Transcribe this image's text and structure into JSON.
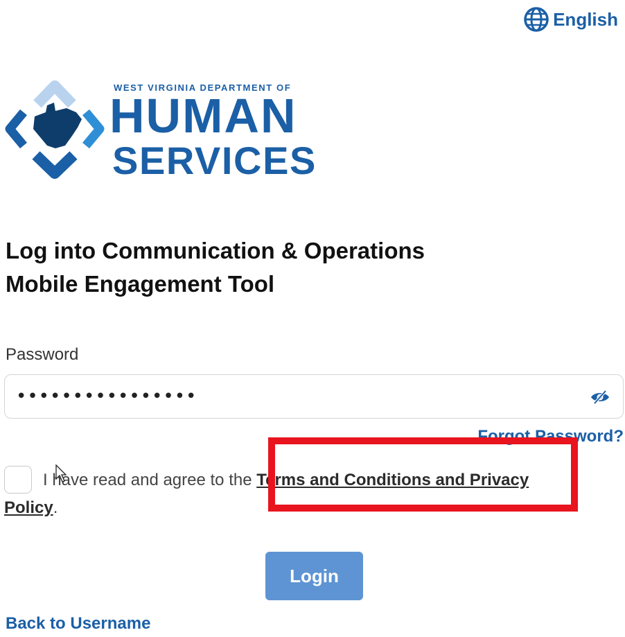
{
  "header": {
    "language_label": "English",
    "language_icon": "globe-icon"
  },
  "logo": {
    "line1": "WEST VIRGINIA DEPARTMENT OF",
    "line2": "HUMAN",
    "line3": "SERVICES"
  },
  "page": {
    "title_line1": "Log into Communication & Operations",
    "title_line2": "Mobile Engagement Tool"
  },
  "form": {
    "password_label": "Password",
    "password_value": "••••••••••••••••",
    "password_visibility_icon": "eye-slash-icon",
    "forgot_password": "Forgot Password?",
    "agree_prefix": "I have read and agree to the",
    "terms_link": "Terms and Conditions and Privacy Policy",
    "agree_suffix": ".",
    "checkbox_checked": false,
    "login_button": "Login",
    "back_link": "Back to Username"
  },
  "colors": {
    "brand_blue": "#1b5fa6",
    "button_blue": "#5e94d3",
    "highlight_red": "#e8141e"
  }
}
